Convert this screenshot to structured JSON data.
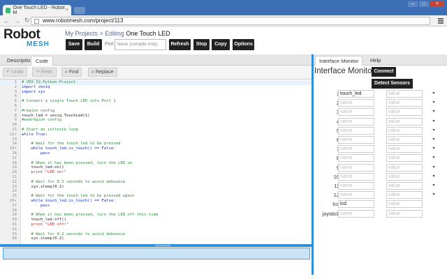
{
  "browser": {
    "tab_title": "One Touch LED - Robot M",
    "url": "www.robotmesh.com/project/113"
  },
  "brand": {
    "robot": "Robot",
    "mesh": "MESH"
  },
  "breadcrumb": {
    "projects": "My Projects",
    "sep": " > ",
    "editing": "Editing ",
    "project": "One Touch LED"
  },
  "toolbar": {
    "save": "Save",
    "build": "Build",
    "port_label": "Port",
    "port_value": "None (compile only)",
    "refresh": "Refresh",
    "stop": "Stop",
    "copy": "Copy",
    "options": "Options"
  },
  "left_tabs": [
    "Description",
    "Code"
  ],
  "editor_toolbar": {
    "undo": "↶ Undo",
    "redo": "↷ Redo",
    "find": "⌕ Find",
    "replace": "⌕ Replace"
  },
  "code": [
    {
      "n": "1",
      "t": "# VEX IQ Python-Project",
      "c": "c-com"
    },
    {
      "n": "2",
      "t": "import vexiq",
      "c": "c-kw"
    },
    {
      "n": "3",
      "t": "import sys",
      "c": "c-kw"
    },
    {
      "n": "4",
      "t": "",
      "c": "c-def"
    },
    {
      "n": "5",
      "t": "# Connect a single Touch LED into Port 1",
      "c": "c-com"
    },
    {
      "n": "6",
      "t": "",
      "c": "c-def"
    },
    {
      "n": "7",
      "t": "#region config",
      "c": "c-com"
    },
    {
      "n": "8",
      "t": "touch_led = vexiq.TouchLed(1)",
      "c": "c-def"
    },
    {
      "n": "9",
      "t": "#endregion config",
      "c": "c-com"
    },
    {
      "n": "10",
      "t": "",
      "c": "c-def"
    },
    {
      "n": "11",
      "t": "# Start an infinite loop",
      "c": "c-com"
    },
    {
      "n": "12▾",
      "t": "while True:",
      "c": "c-kw"
    },
    {
      "n": "13",
      "t": "",
      "c": "c-def"
    },
    {
      "n": "14",
      "t": "    # Wait for the touch_led to be pressed",
      "c": "c-com"
    },
    {
      "n": "15▾",
      "t": "    while touch_led.is_touch() == False:",
      "c": "c-kw"
    },
    {
      "n": "16",
      "t": "        pass",
      "c": "c-kw"
    },
    {
      "n": "17",
      "t": "",
      "c": "c-def"
    },
    {
      "n": "18",
      "t": "    # When it has been pressed, turn the LED on",
      "c": "c-com"
    },
    {
      "n": "19",
      "t": "    touch_led.on()",
      "c": "c-def"
    },
    {
      "n": "20",
      "t": "    print \"LED on!\"",
      "c": "c-str"
    },
    {
      "n": "21",
      "t": "",
      "c": "c-def"
    },
    {
      "n": "22",
      "t": "    # Wait for 0.2 seconds to avoid debounce",
      "c": "c-com"
    },
    {
      "n": "23",
      "t": "    sys.sleep(0.2)",
      "c": "c-def"
    },
    {
      "n": "24",
      "t": "",
      "c": "c-def"
    },
    {
      "n": "25",
      "t": "    # Wait for the touch_led to be pressed again",
      "c": "c-com"
    },
    {
      "n": "26▾",
      "t": "    while touch_led.is_touch() == False:",
      "c": "c-kw"
    },
    {
      "n": "27",
      "t": "        pass",
      "c": "c-kw"
    },
    {
      "n": "28",
      "t": "",
      "c": "c-def"
    },
    {
      "n": "29",
      "t": "    # When it has been pressed, turn the LED off this time",
      "c": "c-com"
    },
    {
      "n": "30",
      "t": "    touch_led.off()",
      "c": "c-def"
    },
    {
      "n": "31",
      "t": "    print \"LED off!\"",
      "c": "c-str"
    },
    {
      "n": "32",
      "t": "",
      "c": "c-def"
    },
    {
      "n": "33",
      "t": "    # Wait for 0.2 seconds to avoid debounce",
      "c": "c-com"
    },
    {
      "n": "34",
      "t": "    sys.sleep(0.2)",
      "c": "c-def"
    }
  ],
  "right_tabs": [
    "Interface Monitor",
    "Help"
  ],
  "monitor": {
    "title": "Interface Monitor",
    "connect": "Connect",
    "detect": "Detect Sensors",
    "name_placeholder": "name",
    "value_placeholder": "value",
    "rows": [
      {
        "label": "1",
        "name": "touch_led"
      },
      {
        "label": "2",
        "name": ""
      },
      {
        "label": "3",
        "name": ""
      },
      {
        "label": "4",
        "name": ""
      },
      {
        "label": "5",
        "name": ""
      },
      {
        "label": "6",
        "name": ""
      },
      {
        "label": "7",
        "name": ""
      },
      {
        "label": "8",
        "name": ""
      },
      {
        "label": "9",
        "name": ""
      },
      {
        "label": "10",
        "name": ""
      },
      {
        "label": "11",
        "name": ""
      },
      {
        "label": "12",
        "name": ""
      },
      {
        "label": "lcd",
        "name": "lcd"
      },
      {
        "label": "joystick",
        "name": ""
      }
    ]
  }
}
